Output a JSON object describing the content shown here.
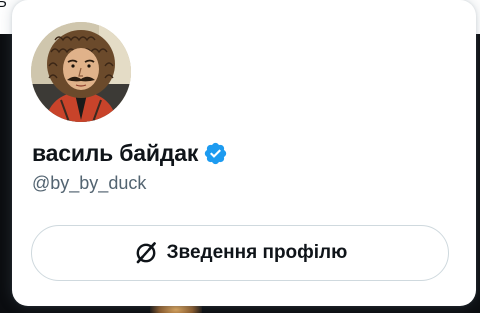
{
  "background": {
    "top_text": "Ь"
  },
  "hover_card": {
    "avatar_alt": "profile-photo",
    "display_name": "василь байдак",
    "verified": true,
    "handle": "@by_by_duck",
    "profile_summary_button_label": "Зведення профілю"
  },
  "colors": {
    "text_primary": "#0f1419",
    "text_secondary": "#536471",
    "verified_blue": "#1d9bf0",
    "border": "#cfd9de",
    "card_bg": "#ffffff",
    "page_bg": "#0b0d10"
  },
  "icons": {
    "verified": "verified-badge-icon",
    "summary": "grok-summary-icon"
  }
}
